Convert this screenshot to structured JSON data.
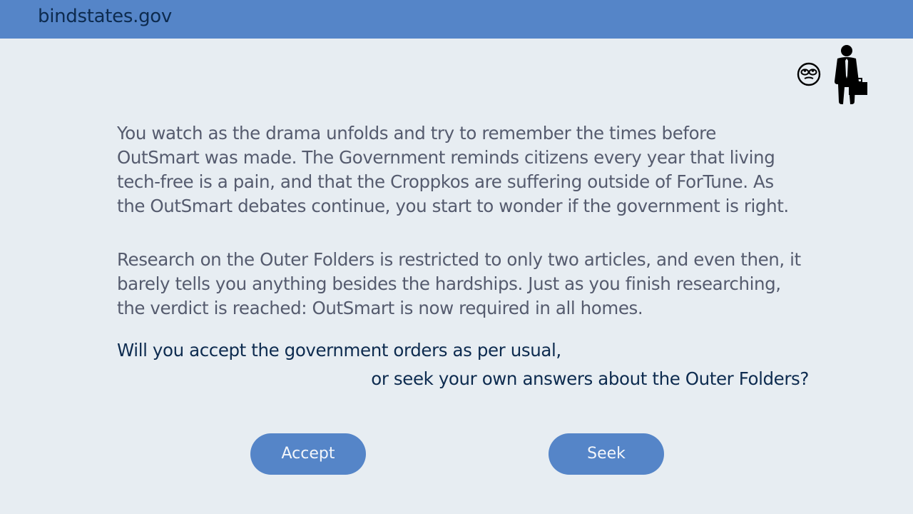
{
  "header": {
    "site_name": "bindstates.gov"
  },
  "status_icons": [
    "rolling-eyes-face-icon",
    "businessman-with-briefcase-icon"
  ],
  "story": {
    "paragraphs": [
      "You watch as the drama unfolds and try to remember the times before\nOutSmart was made. The Government reminds citizens every year that living\ntech-free is a pain, and that the Croppkos are suffering outside of ForTune. As\nthe OutSmart debates continue, you start to wonder if the government is right.",
      "Research on the Outer Folders is restricted to only two articles, and even then, it\nbarely tells you anything besides the hardships. Just as you finish researching,\nthe verdict is reached: OutSmart is now required in all homes."
    ]
  },
  "question": {
    "line1": "Will you accept the government orders as per usual,",
    "line2": "or seek your own answers about the Outer Folders?"
  },
  "choices": {
    "accept_label": "Accept",
    "seek_label": "Seek"
  },
  "colors": {
    "header_bg": "#5585c8",
    "page_bg": "#e7edf2",
    "story_text": "#555b6e",
    "question_text": "#0d2b4f",
    "button_bg": "#5585c8"
  }
}
